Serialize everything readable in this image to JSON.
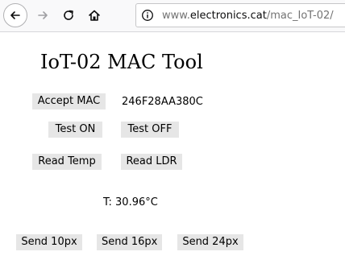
{
  "browser": {
    "url_prefix": "www.",
    "url_domain": "electronics.cat",
    "url_path": "/mac_IoT-02/",
    "icons": {
      "back": "back-arrow-icon",
      "forward": "forward-arrow-icon",
      "reload": "reload-icon",
      "home": "home-icon",
      "site_info": "info-icon"
    }
  },
  "page": {
    "title": "IoT-02 MAC Tool",
    "accept_mac_label": "Accept MAC",
    "mac_value": "246F28AA380C",
    "test_on_label": "Test ON",
    "test_off_label": "Test OFF",
    "read_temp_label": "Read Temp",
    "read_ldr_label": "Read LDR",
    "temp_readout": "T: 30.96°C",
    "send_10px_label": "Send 10px",
    "send_16px_label": "Send 16px",
    "send_24px_label": "Send 24px"
  },
  "colors": {
    "button_bg": "#e6e6e6",
    "toolbar_bg": "#f9f9fa"
  }
}
